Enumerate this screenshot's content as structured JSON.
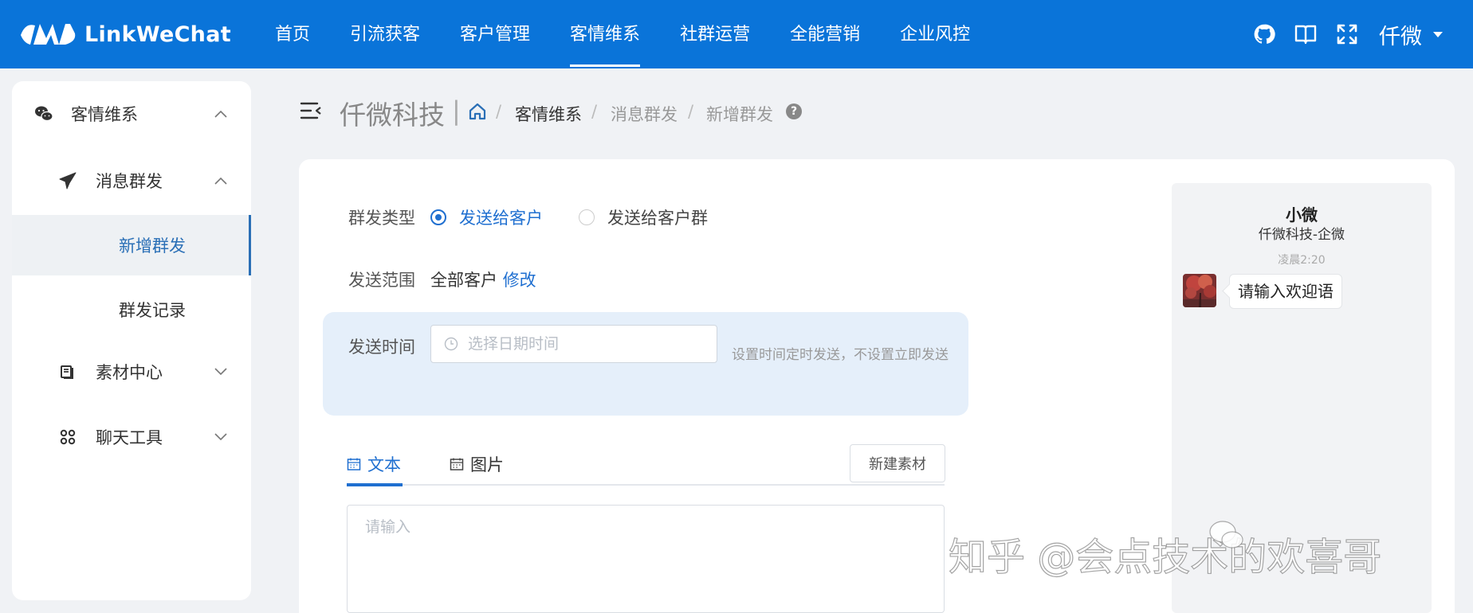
{
  "app": {
    "name": "LinkWeChat",
    "user": "仟微"
  },
  "topnav": [
    {
      "label": "首页"
    },
    {
      "label": "引流获客"
    },
    {
      "label": "客户管理"
    },
    {
      "label": "客情维系",
      "active": true
    },
    {
      "label": "社群运营"
    },
    {
      "label": "全能营销"
    },
    {
      "label": "企业风控"
    }
  ],
  "topnav_icons": [
    "github-icon",
    "book-icon",
    "fullscreen-icon"
  ],
  "sidebar": {
    "items": [
      {
        "label": "客情维系",
        "icon": "wechat-icon",
        "expanded": true
      },
      {
        "label": "消息群发",
        "icon": "paper-plane-icon",
        "expanded": true
      },
      {
        "label": "新增群发",
        "active": true
      },
      {
        "label": "群发记录"
      },
      {
        "label": "素材中心",
        "icon": "library-icon",
        "expanded": false
      },
      {
        "label": "聊天工具",
        "icon": "apps-icon",
        "expanded": false
      }
    ]
  },
  "header": {
    "company": "仟微科技",
    "separator": "|",
    "breadcrumb": [
      "客情维系",
      "消息群发",
      "新增群发"
    ],
    "breadcrumb_sep": "/",
    "help": "?"
  },
  "form": {
    "type_label": "群发类型",
    "type_options": [
      {
        "label": "发送给客户",
        "checked": true
      },
      {
        "label": "发送给客户群",
        "checked": false
      }
    ],
    "range_label": "发送范围",
    "range_value": "全部客户",
    "range_edit": "修改",
    "time_label": "发送时间",
    "time_placeholder": "选择日期时间",
    "time_hint": "设置时间定时发送，不设置立即发送"
  },
  "content": {
    "tabs": [
      {
        "label": "文本",
        "active": true
      },
      {
        "label": "图片",
        "active": false
      }
    ],
    "new_material": "新建素材",
    "textarea_placeholder": "请输入"
  },
  "preview": {
    "name": "小微",
    "sub": "仟微科技-企微",
    "time": "凌晨2:20",
    "bubble": "请输入欢迎语"
  },
  "watermark": "知乎 @会点技术的欢喜哥",
  "colors": {
    "topbar": "#0a74d9",
    "accent": "#1f6fd0",
    "active_menu": "#2a6fb6",
    "time_panel": "#e5effa"
  }
}
